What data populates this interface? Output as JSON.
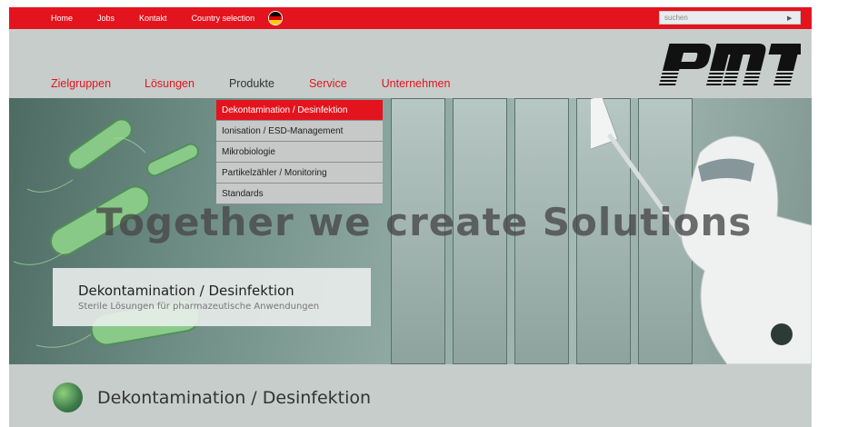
{
  "topbar": {
    "nav": [
      "Home",
      "Jobs",
      "Kontakt",
      "Country selection"
    ],
    "flag_icon": "germany-flag-icon",
    "search_placeholder": "suchen",
    "search_go_icon": "arrow-right-icon"
  },
  "logo": {
    "text": "PMT"
  },
  "mainnav": {
    "items": [
      {
        "label": "Zielgruppen"
      },
      {
        "label": "Lösungen"
      },
      {
        "label": "Produkte"
      },
      {
        "label": "Service"
      },
      {
        "label": "Unternehmen"
      }
    ],
    "active": "Produkte"
  },
  "dropdown": {
    "items": [
      "Dekontamination / Desinfektion",
      "Ionisation / ESD-Management",
      "Mikrobiologie",
      "Partikelzähler / Monitoring",
      "Standards"
    ],
    "active_index": 0
  },
  "hero": {
    "tagline": "Together we create Solutions",
    "caption_title": "Dekontamination / Desinfektion",
    "caption_subtitle": "Sterile Lösungen für pharmazeutische Anwendungen"
  },
  "page": {
    "title": "Dekontamination / Desinfektion"
  },
  "colors": {
    "brand_red": "#e3141e",
    "background": "#c7cdcb"
  }
}
